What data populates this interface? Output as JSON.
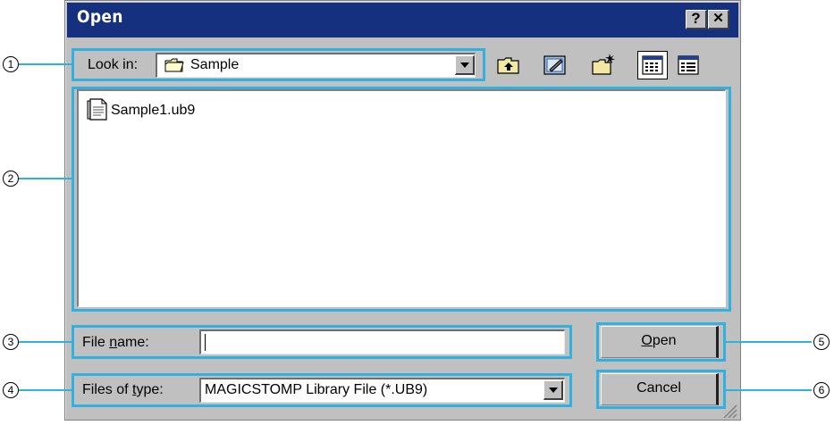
{
  "window": {
    "title": "Open",
    "help_label": "?",
    "close_label": "✕"
  },
  "look_in": {
    "label": "Look in:",
    "value": "Sample"
  },
  "toolbar": {
    "up_icon": "up-one-level-icon",
    "desktop_icon": "desktop-icon",
    "new_folder_icon": "new-folder-icon",
    "list_icon": "list-view-icon",
    "details_icon": "details-view-icon"
  },
  "files": [
    {
      "name": "Sample1.ub9",
      "icon": "document-icon"
    }
  ],
  "file_name": {
    "label_pre": "File ",
    "label_u": "n",
    "label_post": "ame:",
    "value": ""
  },
  "file_type": {
    "label_pre": "Files of ",
    "label_u": "t",
    "label_post": "ype:",
    "value": "MAGICSTOMP Library File (*.UB9)"
  },
  "buttons": {
    "open_u": "O",
    "open_rest": "pen",
    "cancel": "Cancel"
  },
  "callouts": [
    "1",
    "2",
    "3",
    "4",
    "5",
    "6"
  ],
  "colors": {
    "titlebar": "#14307e",
    "callout": "#31b1e0",
    "face": "#c0c0c0"
  }
}
